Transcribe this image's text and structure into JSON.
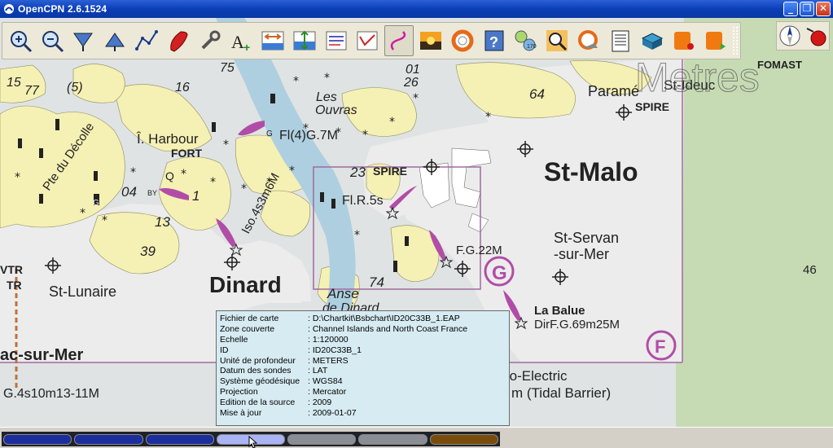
{
  "window": {
    "title": "OpenCPN 2.6.1524",
    "minimize_glyph": "_",
    "maximize_glyph": "❐",
    "close_glyph": "✕"
  },
  "toolbar": {
    "buttons": [
      {
        "name": "zoom-in-icon"
      },
      {
        "name": "zoom-out-icon"
      },
      {
        "name": "scale-down-icon"
      },
      {
        "name": "scale-up-icon"
      },
      {
        "name": "route-icon"
      },
      {
        "name": "follow-ship-icon"
      },
      {
        "name": "settings-icon"
      },
      {
        "name": "text-icon"
      },
      {
        "name": "current-icon"
      },
      {
        "name": "tide-icon"
      },
      {
        "name": "print-icon"
      },
      {
        "name": "route-manager-icon"
      },
      {
        "name": "track-icon"
      },
      {
        "name": "color-scheme-icon"
      },
      {
        "name": "mob-icon"
      },
      {
        "name": "help-icon"
      },
      {
        "name": "ais-icon"
      },
      {
        "name": "search-icon"
      },
      {
        "name": "about-icon"
      },
      {
        "name": "document-icon"
      },
      {
        "name": "plugin-icon-1"
      },
      {
        "name": "plugin-icon-2"
      },
      {
        "name": "plugin-icon-3"
      }
    ],
    "active_button": "track-icon"
  },
  "chart_labels": {
    "st_malo": "St-Malo",
    "dinard": "Dinard",
    "st_lunaire": "St-Lunaire",
    "st_servan": "St-Servan",
    "sur_mer": "-sur-Mer",
    "parame": "Paramé",
    "st_ideuc": "St-Ideuc",
    "spire1": "SPIRE",
    "spire2": "SPIRE",
    "harbour": "Î. Harbour",
    "fort": "FORT",
    "les_ouvras": "Les",
    "les_ouvras2": "Ouvras",
    "fl4": "Fl(4)G.7M",
    "flr5s": "Fl.R.5s",
    "fg22m": "F.G.22M",
    "iso": "Iso.4s3m6M",
    "pte": "Pte du Décolle",
    "anse": "Anse",
    "de_dinard": "de Dinard",
    "la_balue": "La Balue",
    "dirfg": "DirF.G.69m25M",
    "dinard_sea": "ac-sur-Mer",
    "electric": "ro-Electric",
    "tidal": "m (Tidal Barrier)",
    "bottom_left": "G.4s10m13-11M",
    "fomast": "FOMAST",
    "metres": "Metres",
    "vtr": "VTR",
    "tr": "TR",
    "g_letter": "G",
    "f_letter": "F",
    "q_letter": "Q",
    "by": "BY",
    "g_small": "G",
    "g_small2": "G",
    "depth_46": "46",
    "depth_0_4": "04",
    "depth_1": "1",
    "depth_1_3": "13",
    "depth_3_9": "39",
    "depth_2_3": "23",
    "depth_7_4": "74",
    "depth_6_4": "64",
    "depth_5": "(5)",
    "depth_15": "15",
    "depth_77": "77",
    "depth_16": "16",
    "depth_75": "75",
    "depth_01": "01",
    "depth_26": "26"
  },
  "chart_info": {
    "rows": [
      {
        "key": "Fichier de carte",
        "value": ": D:\\Chartkit\\Bsbchart\\ID20C33B_1.EAP"
      },
      {
        "key": "Zone couverte",
        "value": ": Channel Islands and North Coast France"
      },
      {
        "key": "Echelle",
        "value": ": 1:120000"
      },
      {
        "key": "ID",
        "value": ": ID20C33B_1"
      },
      {
        "key": "Unité de profondeur",
        "value": ": METERS"
      },
      {
        "key": "Datum des sondes",
        "value": ": LAT"
      },
      {
        "key": "Système géodésique",
        "value": ": WGS84"
      },
      {
        "key": "Projection",
        "value": ": Mercator"
      },
      {
        "key": "Edition de la source",
        "value": ": 2009"
      },
      {
        "key": "Mise à jour",
        "value": ": 2009-01-07"
      }
    ]
  },
  "piano": {
    "keys": [
      {
        "color": "#1c2d9c"
      },
      {
        "color": "#1c2d9c"
      },
      {
        "color": "#1c2d9c"
      },
      {
        "color": "#a9b3f5"
      },
      {
        "color": "#8a8e94"
      },
      {
        "color": "#8a8e94"
      },
      {
        "color": "#7a4c0c"
      }
    ]
  },
  "colors": {
    "land": "#f5f0b4",
    "sea": "#dfe3e3",
    "shoal": "#ffffff",
    "magenta": "#b14da7",
    "boundary": "#a06aa0"
  }
}
